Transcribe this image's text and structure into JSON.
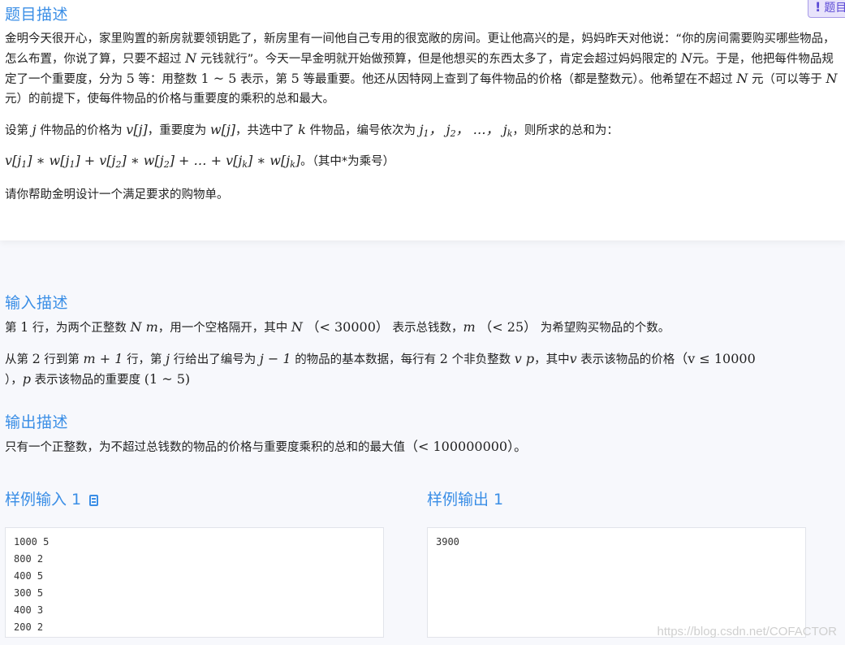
{
  "badge": {
    "label": "题目"
  },
  "problem": {
    "title": "题目描述",
    "p1_a": "金明今天很开心，家里购置的新房就要领钥匙了，新房里有一间他自己专用的很宽敞的房间。更让他高兴的是，妈妈昨天对他说：“你的房间需要购买哪些物品，怎么布置，你说了算，只要不超过",
    "p1_b": "元钱就行”。今天一早金明就开始做预算，但是他想买的东西太多了，肯定会超过妈妈限定的",
    "p1_c": "元。于是，他把每件物品规定了一个重要度，分为",
    "p1_d": "等：用整数",
    "p1_e": "表示，第",
    "p1_f": "等最重要。他还从因特网上查到了每件物品的价格（都是整数元）。他希望在不超过",
    "p1_g": "元（可以等于",
    "p1_h": "元）的前提下，使每件物品的价格与重要度的乘积的总和最大。",
    "p2_a": "设第",
    "p2_b": "件物品的价格为",
    "p2_c": "，重要度为",
    "p2_d": "，共选中了",
    "p2_e": "件物品，编号依次为",
    "p2_f": "，则所求的总和为：",
    "formula_note": "。（其中*为乘号）",
    "p4": "请你帮助金明设计一个满足要求的购物单。",
    "var_N": "N",
    "num_5": "5",
    "range_1_5": "1 ~ 5",
    "var_j": "j",
    "expr_vj": "v[j]",
    "expr_wj": "w[j]",
    "var_k": "k"
  },
  "input": {
    "title": "输入描述",
    "l1_a": "第",
    "l1_num": "1",
    "l1_b": "行，为两个正整数",
    "l1_c": "，用一个空格隔开，其中",
    "l1_d": "表示总钱数，",
    "l1_e": "为希望购买物品的个数。",
    "l2_a": "从第",
    "l2_num": "2",
    "l2_b": "行到第",
    "l2_c": "行，第",
    "l2_d": "行给出了编号为",
    "l2_e": "的物品的基本数据，每行有",
    "l2_num2": "2",
    "l2_f": "个非负整数",
    "l2_g": "，其中",
    "l2_h": "表示该物品的价格",
    "l2_i": "，",
    "l2_j": "表示该物品的重要度",
    "expr_Nm": "N m",
    "expr_N_lt": "（< 30000）",
    "expr_m_lt": "（< 25）",
    "expr_m1": "m + 1",
    "expr_j1": "j − 1",
    "expr_vp": "v p",
    "expr_v_le": "（v ≤ 10000",
    "expr_close": "）",
    "expr_imp": "(1 ~ 5)"
  },
  "output": {
    "title": "输出描述",
    "text_a": "只有一个正整数，为不超过总钱数的物品的价格与重要度乘积的总和的最大值",
    "text_b": "（< 100000000）。"
  },
  "sample_input": {
    "title": "样例输入 1",
    "lines": [
      "1000 5",
      "800 2",
      "400 5",
      "300 5",
      "400 3",
      "200 2"
    ]
  },
  "sample_output": {
    "title": "样例输出 1",
    "lines": [
      "3900"
    ]
  },
  "watermark": "https://blog.csdn.net/COFACTOR"
}
